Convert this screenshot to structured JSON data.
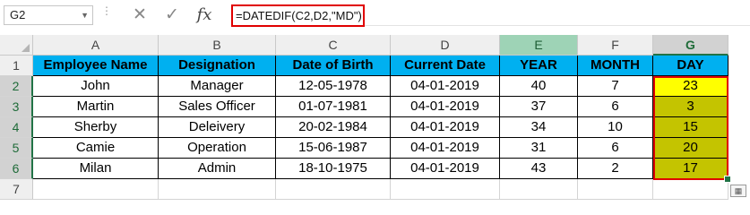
{
  "formula_bar": {
    "name_box": "G2",
    "cancel_icon": "✕",
    "enter_icon": "✓",
    "function_label": "fx",
    "formula": "=DATEDIF(C2,D2,\"MD\")"
  },
  "sheet": {
    "columns": [
      "A",
      "B",
      "C",
      "D",
      "E",
      "F",
      "G"
    ],
    "rows": [
      "1",
      "2",
      "3",
      "4",
      "5",
      "6",
      "7"
    ],
    "headers": [
      "Employee Name",
      "Designation",
      "Date of Birth",
      "Current Date",
      "YEAR",
      "MONTH",
      "DAY"
    ],
    "data": [
      [
        "John",
        "Manager",
        "12-05-1978",
        "04-01-2019",
        "40",
        "7",
        "23"
      ],
      [
        "Martin",
        "Sales Officer",
        "01-07-1981",
        "04-01-2019",
        "37",
        "6",
        "3"
      ],
      [
        "Sherby",
        "Deleivery",
        "20-02-1984",
        "04-01-2019",
        "34",
        "10",
        "15"
      ],
      [
        "Camie",
        "Operation",
        "15-06-1987",
        "04-01-2019",
        "31",
        "6",
        "20"
      ],
      [
        "Milan",
        "Admin",
        "18-10-1975",
        "04-01-2019",
        "43",
        "2",
        "17"
      ]
    ]
  },
  "colors": {
    "header_fill": "#00b0f0",
    "active_cell_fill": "#ffff00",
    "day_fill": "#c4c400",
    "selection_border": "#e00000",
    "excel_green": "#217346"
  }
}
